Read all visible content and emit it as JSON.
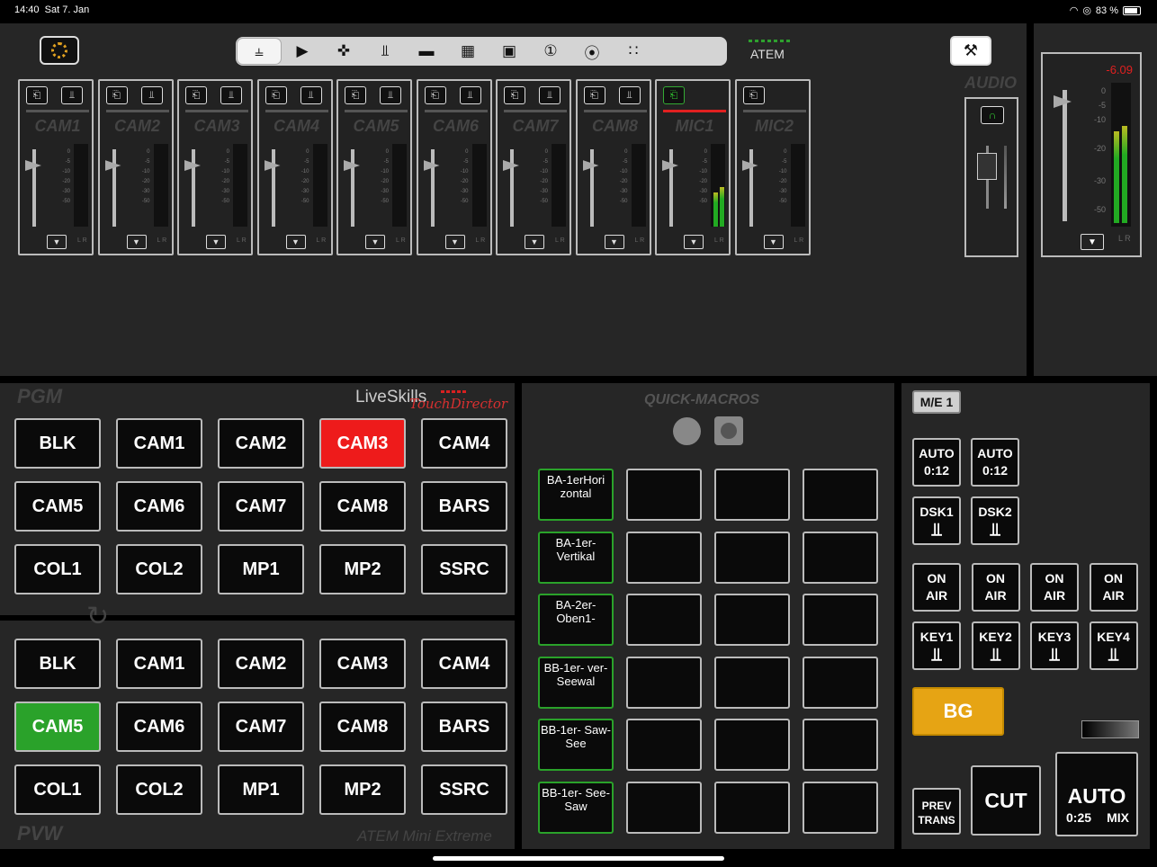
{
  "status_bar": {
    "time": "14:40",
    "date": "Sat 7. Jan",
    "battery": "83 %"
  },
  "toolbar": {
    "icons": [
      "mixer-sliders-icon",
      "play-icon",
      "move-icon",
      "merge-icon",
      "display-icon",
      "multiview-icon",
      "window-icon",
      "timer-icon",
      "broadcast-icon",
      "more-icon"
    ],
    "atem_label": "ATEM"
  },
  "audio": {
    "section_label": "AUDIO",
    "channels": [
      {
        "name": "CAM1"
      },
      {
        "name": "CAM2"
      },
      {
        "name": "CAM3"
      },
      {
        "name": "CAM4"
      },
      {
        "name": "CAM5"
      },
      {
        "name": "CAM6"
      },
      {
        "name": "CAM7"
      },
      {
        "name": "CAM8"
      },
      {
        "name": "MIC1"
      },
      {
        "name": "MIC2"
      }
    ],
    "scale": [
      "0",
      "-5",
      "-10",
      "-20",
      "-30",
      "-50"
    ],
    "lr": "L R",
    "master_db": "-6.09",
    "master_scale": [
      "0",
      "-5",
      "-10",
      "-20",
      "-30",
      "-50"
    ]
  },
  "pgm": {
    "title": "PGM",
    "buttons": [
      "BLK",
      "CAM1",
      "CAM2",
      "CAM3",
      "CAM4",
      "CAM5",
      "CAM6",
      "CAM7",
      "CAM8",
      "BARS",
      "COL1",
      "COL2",
      "MP1",
      "MP2",
      "SSRC"
    ],
    "active": "CAM3",
    "active_color": "#ee1b1b"
  },
  "pvw": {
    "title": "PVW",
    "buttons": [
      "BLK",
      "CAM1",
      "CAM2",
      "CAM3",
      "CAM4",
      "CAM5",
      "CAM6",
      "CAM7",
      "CAM8",
      "BARS",
      "COL1",
      "COL2",
      "MP1",
      "MP2",
      "SSRC"
    ],
    "active": "CAM5",
    "active_color": "#2aa22a"
  },
  "brand": {
    "name": "LiveSkills",
    "sub": "TouchDirector",
    "model": "ATEM Mini Extreme"
  },
  "macros": {
    "title": "QUICK-MACROS",
    "rows": [
      [
        "BA-1erHori zontal",
        "",
        "",
        ""
      ],
      [
        "BA-1er- Vertikal",
        "",
        "",
        ""
      ],
      [
        "BA-2er- Oben1-",
        "",
        "",
        ""
      ],
      [
        "BB-1er- ver-Seewal",
        "",
        "",
        ""
      ],
      [
        "BB-1er- Saw-See",
        "",
        "",
        ""
      ],
      [
        "BB-1er- See-Saw",
        "",
        "",
        ""
      ]
    ]
  },
  "me": {
    "me_label": "M/E 1",
    "auto1": {
      "line1": "AUTO",
      "line2": "0:12"
    },
    "auto2": {
      "line1": "AUTO",
      "line2": "0:12"
    },
    "dsk1": "DSK1",
    "dsk2": "DSK2",
    "on_air": [
      {
        "line1": "ON",
        "line2": "AIR"
      },
      {
        "line1": "ON",
        "line2": "AIR"
      },
      {
        "line1": "ON",
        "line2": "AIR"
      },
      {
        "line1": "ON",
        "line2": "AIR"
      }
    ],
    "keys": [
      "KEY1",
      "KEY2",
      "KEY3",
      "KEY4"
    ],
    "bg": "BG",
    "prev_line1": "PREV",
    "prev_line2": "TRANS",
    "cut": "CUT",
    "auto_mix": {
      "label": "AUTO",
      "time": "0:25",
      "mode": "MIX"
    },
    "accent": "#e6a414"
  }
}
